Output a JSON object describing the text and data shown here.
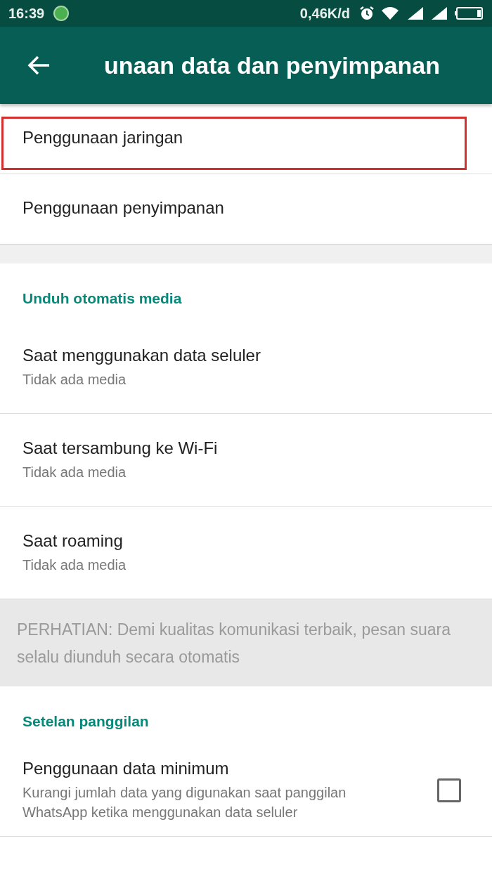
{
  "status_bar": {
    "time": "16:39",
    "speed": "0,46K/d"
  },
  "toolbar": {
    "title": "unaan data dan penyimpanan"
  },
  "top_items": [
    {
      "label": "Penggunaan jaringan",
      "highlighted": true
    },
    {
      "label": "Penggunaan penyimpanan",
      "highlighted": false
    }
  ],
  "sections": [
    {
      "header": "Unduh otomatis media",
      "items": [
        {
          "kind": "option",
          "title": "Saat menggunakan data seluler",
          "subtitle": "Tidak ada media"
        },
        {
          "kind": "option",
          "title": "Saat tersambung ke Wi-Fi",
          "subtitle": "Tidak ada media"
        },
        {
          "kind": "option",
          "title": "Saat roaming",
          "subtitle": "Tidak ada media"
        }
      ],
      "notice": "PERHATIAN: Demi kualitas komunikasi terbaik, pesan suara selalu diunduh secara otomatis"
    },
    {
      "header": "Setelan panggilan",
      "items": [
        {
          "kind": "checkbox",
          "title": "Penggunaan data minimum",
          "subtitle": "Kurangi jumlah data yang digunakan saat panggilan WhatsApp ketika menggunakan data seluler",
          "checked": false
        }
      ]
    }
  ]
}
